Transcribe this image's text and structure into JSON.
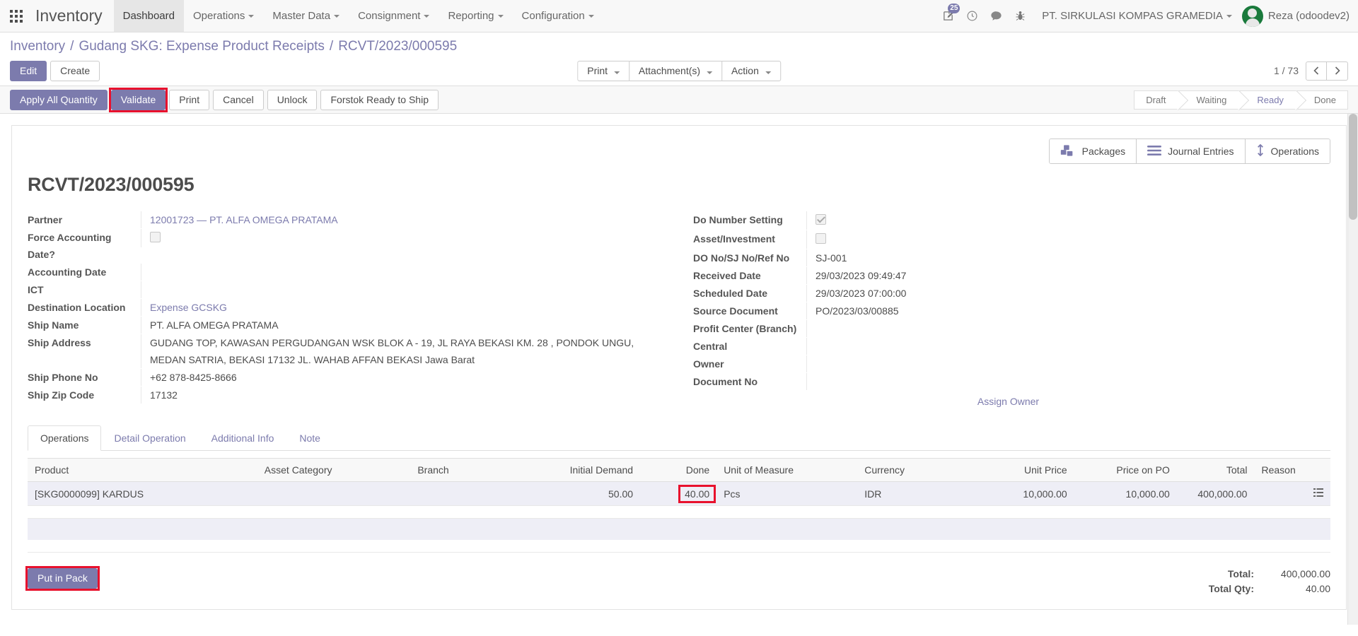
{
  "navbar": {
    "apps_icon": "apps-grid-icon",
    "brand": "Inventory",
    "menus": [
      {
        "label": "Dashboard",
        "has_caret": false,
        "active": true
      },
      {
        "label": "Operations",
        "has_caret": true,
        "active": false
      },
      {
        "label": "Master Data",
        "has_caret": true,
        "active": false
      },
      {
        "label": "Consignment",
        "has_caret": true,
        "active": false
      },
      {
        "label": "Reporting",
        "has_caret": true,
        "active": false
      },
      {
        "label": "Configuration",
        "has_caret": true,
        "active": false
      }
    ],
    "activity_badge": "25",
    "icons": [
      "edit-note-icon",
      "clock-icon",
      "chat-icon",
      "bug-icon"
    ],
    "company": "PT. SIRKULASI KOMPAS GRAMEDIA",
    "user": "Reza (odoodev2)"
  },
  "breadcrumb": {
    "root": "Inventory",
    "parent": "Gudang SKG: Expense Product Receipts",
    "current": "RCVT/2023/000595",
    "separator": "/"
  },
  "control": {
    "edit_label": "Edit",
    "create_label": "Create",
    "print_label": "Print",
    "attachments_label": "Attachment(s)",
    "action_label": "Action",
    "pager": "1 / 73",
    "prev_icon": "chevron-left-icon",
    "next_icon": "chevron-right-icon"
  },
  "statusbar": {
    "buttons": [
      {
        "label": "Apply All Quantity",
        "primary": true,
        "highlighted": false
      },
      {
        "label": "Validate",
        "primary": true,
        "highlighted": true
      },
      {
        "label": "Print",
        "primary": false,
        "highlighted": false
      },
      {
        "label": "Cancel",
        "primary": false,
        "highlighted": false
      },
      {
        "label": "Unlock",
        "primary": false,
        "highlighted": false
      },
      {
        "label": "Forstok Ready to Ship",
        "primary": false,
        "highlighted": false
      }
    ],
    "states": [
      {
        "label": "Draft",
        "active": false
      },
      {
        "label": "Waiting",
        "active": false
      },
      {
        "label": "Ready",
        "active": true
      },
      {
        "label": "Done",
        "active": false
      }
    ]
  },
  "sheet": {
    "record_title": "RCVT/2023/000595",
    "smart_buttons": [
      {
        "label": "Packages",
        "icon": "packages-boxes-icon"
      },
      {
        "label": "Journal Entries",
        "icon": "list-bars-icon"
      },
      {
        "label": "Operations",
        "icon": "up-down-arrow-icon"
      }
    ],
    "left_fields": [
      {
        "label": "Partner",
        "value": "12001723 — PT. ALFA OMEGA PRATAMA",
        "type": "link"
      },
      {
        "label": "Force Accounting Date?",
        "value": "",
        "type": "checkbox",
        "checked": false
      },
      {
        "label": "Accounting Date",
        "value": "",
        "type": "text"
      },
      {
        "label": "ICT",
        "value": "",
        "type": "text"
      },
      {
        "label": "Destination Location",
        "value": "Expense GCSKG",
        "type": "link"
      },
      {
        "label": "Ship Name",
        "value": "PT. ALFA OMEGA PRATAMA",
        "type": "text"
      },
      {
        "label": "Ship Address",
        "value": "GUDANG TOP, KAWASAN PERGUDANGAN WSK BLOK A - 19, JL RAYA BEKASI KM. 28 , PONDOK UNGU, MEDAN SATRIA, BEKASI 17132 JL. WAHAB AFFAN BEKASI Jawa Barat",
        "type": "text"
      },
      {
        "label": "Ship Phone No",
        "value": "+62 878-8425-8666",
        "type": "text"
      },
      {
        "label": "Ship Zip Code",
        "value": "17132",
        "type": "text"
      }
    ],
    "right_fields": [
      {
        "label": "Do Number Setting",
        "value": "",
        "type": "checkbox",
        "checked": true
      },
      {
        "label": "Asset/Investment",
        "value": "",
        "type": "checkbox",
        "checked": false
      },
      {
        "label": "DO No/SJ No/Ref No",
        "value": "SJ-001",
        "type": "text"
      },
      {
        "label": "Received Date",
        "value": "29/03/2023 09:49:47",
        "type": "text"
      },
      {
        "label": "Scheduled Date",
        "value": "29/03/2023 07:00:00",
        "type": "text"
      },
      {
        "label": "Source Document",
        "value": "PO/2023/03/00885",
        "type": "text"
      },
      {
        "label": "Profit Center (Branch)",
        "value": "",
        "type": "text"
      },
      {
        "label": "Central",
        "value": "",
        "type": "text"
      },
      {
        "label": "Owner",
        "value": "",
        "type": "text"
      },
      {
        "label": "Document No",
        "value": "",
        "type": "text"
      }
    ],
    "assign_owner": "Assign Owner"
  },
  "notebook": {
    "tabs": [
      {
        "label": "Operations",
        "active": true
      },
      {
        "label": "Detail Operation",
        "active": false
      },
      {
        "label": "Additional Info",
        "active": false
      },
      {
        "label": "Note",
        "active": false
      }
    ]
  },
  "lines_table": {
    "columns": [
      {
        "label": "Product",
        "align": "left"
      },
      {
        "label": "Asset Category",
        "align": "left"
      },
      {
        "label": "Branch",
        "align": "left"
      },
      {
        "label": "Initial Demand",
        "align": "right"
      },
      {
        "label": "Done",
        "align": "right"
      },
      {
        "label": "Unit of Measure",
        "align": "left"
      },
      {
        "label": "Currency",
        "align": "left"
      },
      {
        "label": "Unit Price",
        "align": "right"
      },
      {
        "label": "Price on PO",
        "align": "right"
      },
      {
        "label": "Total",
        "align": "right"
      },
      {
        "label": "Reason",
        "align": "left"
      },
      {
        "label": "",
        "align": "left"
      }
    ],
    "rows": [
      {
        "product": "[SKG0000099] KARDUS",
        "asset_category": "",
        "branch": "",
        "initial_demand": "50.00",
        "done": "40.00",
        "done_highlighted": true,
        "unit_of_measure": "Pcs",
        "currency": "IDR",
        "unit_price": "10,000.00",
        "price_on_po": "10,000.00",
        "total": "400,000.00",
        "reason": "",
        "options_icon": "list-options-icon"
      }
    ]
  },
  "footer": {
    "put_in_pack_label": "Put in Pack",
    "put_in_pack_highlighted": true,
    "total_label": "Total:",
    "total_value": "400,000.00",
    "total_qty_label": "Total Qty:",
    "total_qty_value": "40.00"
  },
  "colors": {
    "accent": "#7c7bad",
    "highlight": "#e8112d",
    "row_bg": "#eeeef6",
    "avatar_bg": "#1a7a3c"
  }
}
